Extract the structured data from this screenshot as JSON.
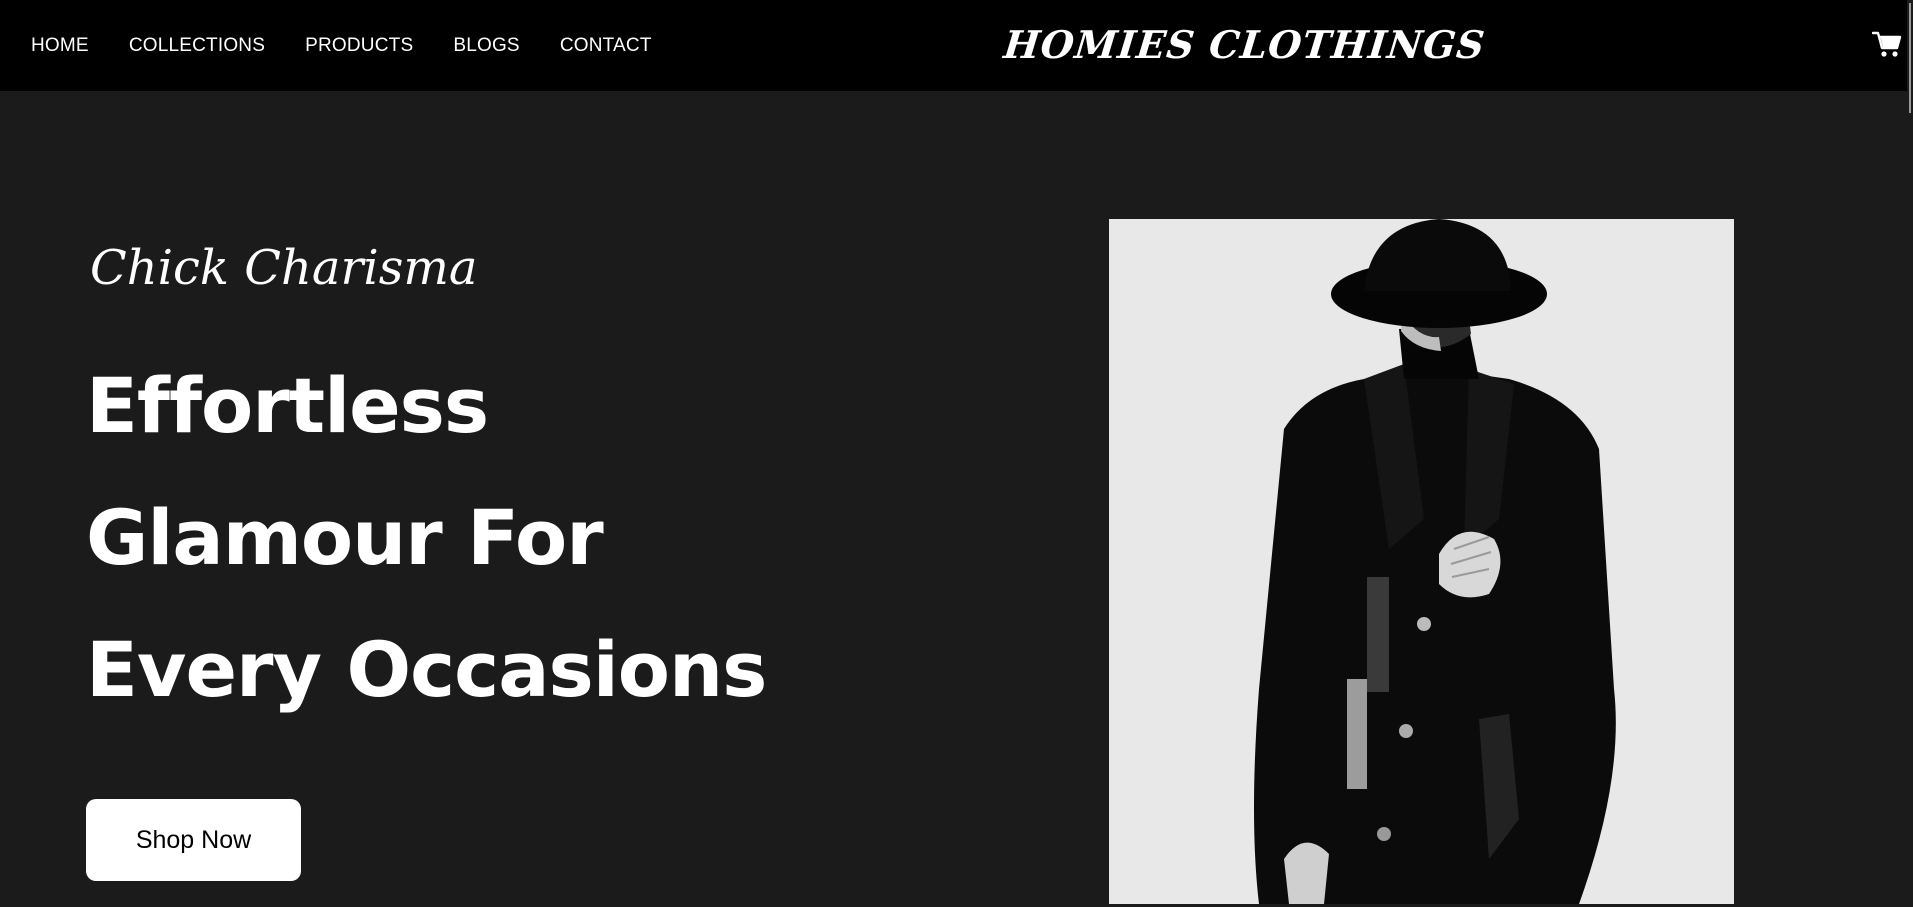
{
  "nav": {
    "items": [
      {
        "label": "HOME"
      },
      {
        "label": "COLLECTIONS"
      },
      {
        "label": "PRODUCTS"
      },
      {
        "label": "BLOGS"
      },
      {
        "label": "CONTACT"
      }
    ]
  },
  "brand": {
    "name": "HOMIES CLOTHINGS"
  },
  "header": {
    "cart_icon": "shopping-cart-icon"
  },
  "hero": {
    "eyebrow": "Chick Charisma",
    "headline": [
      "Effortless",
      "Glamour For",
      "Every Occasions"
    ],
    "cta_label": "Shop Now"
  },
  "colors": {
    "background": "#1b1b1b",
    "topbar": "#000000",
    "text": "#ffffff",
    "button_bg": "#ffffff",
    "button_text": "#000000",
    "photo_bg": "#e6e6e6"
  }
}
